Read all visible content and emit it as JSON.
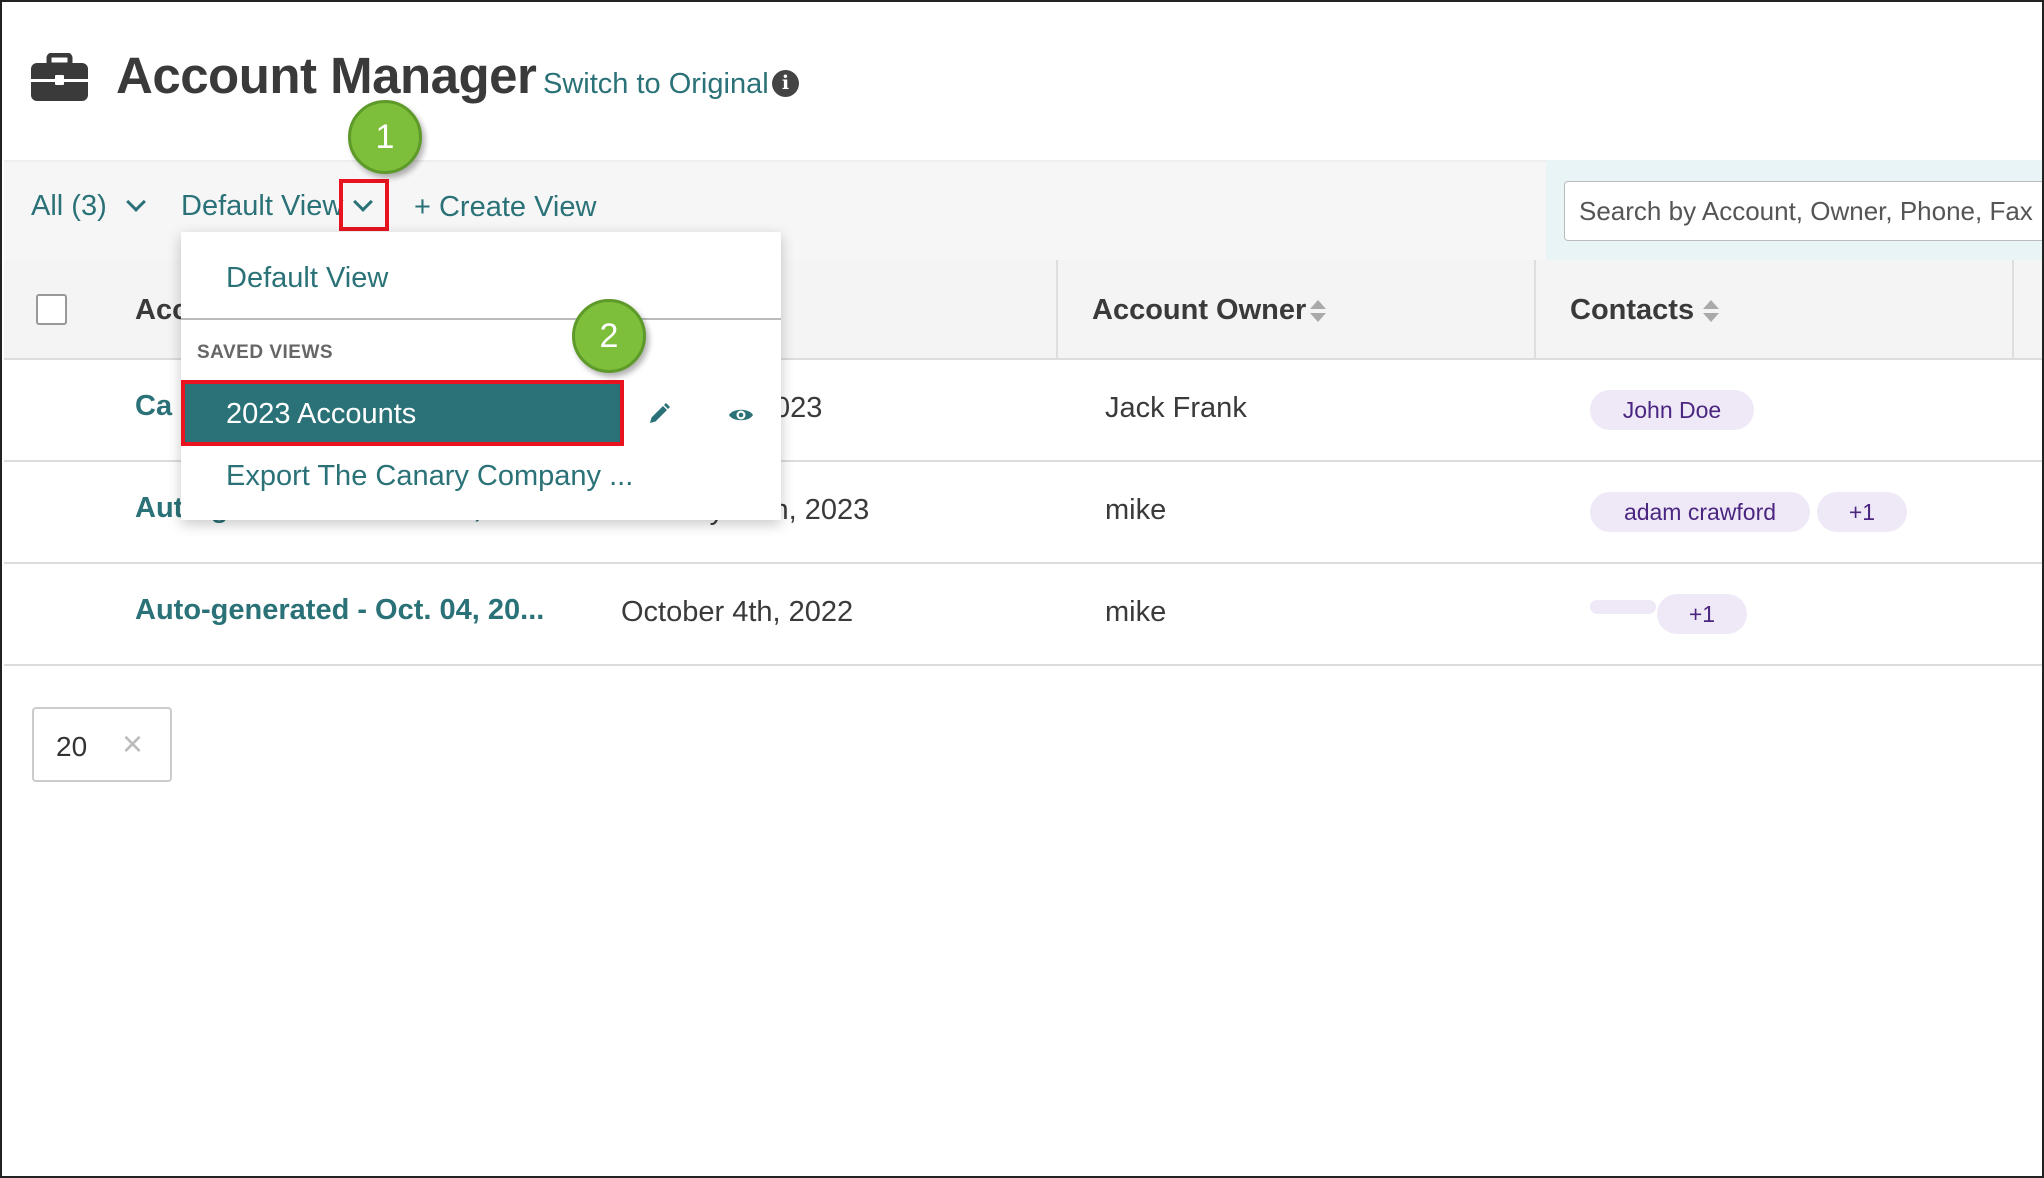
{
  "header": {
    "title": "Account Manager",
    "switch_link": "Switch to Original",
    "info_glyph": "i"
  },
  "toolbar": {
    "all_label": "All",
    "all_count": "(3)",
    "view_label": "Default View",
    "create_view_label": "+ Create View",
    "search_placeholder": "Search by Account, Owner, Phone, Fax"
  },
  "table": {
    "columns": [
      "Acc",
      "Account Owner",
      "Contacts"
    ],
    "rows": [
      {
        "account": "Ca",
        "date": "023",
        "owner": "Jack Frank",
        "contacts": [
          "John Doe"
        ]
      },
      {
        "account": "Auto-generated - Jan. 20, 20...",
        "date": "January 20th, 2023",
        "owner": "mike",
        "contacts": [
          "adam crawford",
          "+1"
        ]
      },
      {
        "account": "Auto-generated - Oct. 04, 20...",
        "date": "October 4th, 2022",
        "owner": "mike",
        "contacts": [
          "",
          "+1"
        ]
      }
    ]
  },
  "pagination": {
    "page_size": "20",
    "clear_glyph": "×"
  },
  "dropdown": {
    "default_view": "Default View",
    "saved_views_heading": "SAVED VIEWS",
    "saved_views": [
      "2023 Accounts",
      "Export The Canary Company ..."
    ]
  },
  "callouts": [
    "1",
    "2"
  ],
  "colors": {
    "brand_teal": "#2a7277",
    "highlight_red": "#e8131f",
    "callout_green": "#7dbe3b",
    "chip_bg": "#efe9f7",
    "chip_text": "#4a2680"
  },
  "icons": {
    "title": "briefcase-icon",
    "info": "info-icon",
    "edit": "pencil-icon",
    "preview": "eye-icon",
    "sort": "sort-icon",
    "dropdown": "chevron-down-icon",
    "clear": "close-icon"
  }
}
